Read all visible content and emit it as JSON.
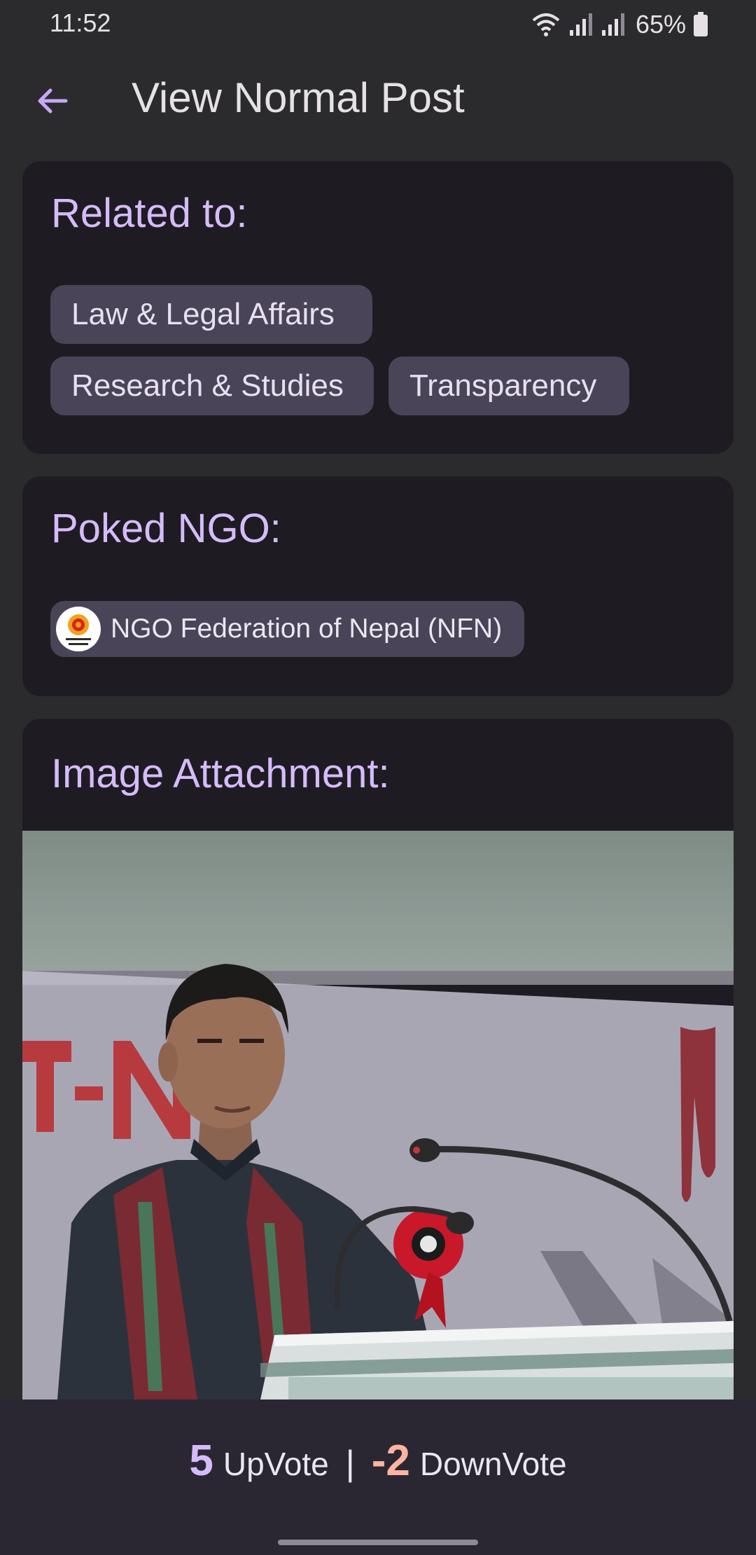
{
  "status_bar": {
    "time": "11:52",
    "battery": "65%"
  },
  "app_bar": {
    "title": "View Normal Post",
    "back_icon": "arrow-left-icon"
  },
  "related": {
    "title": "Related to:",
    "tags": [
      "Law & Legal Affairs",
      "Research & Studies",
      "Transparency"
    ]
  },
  "poked": {
    "title": "Poked NGO:",
    "ngo_name": "NGO Federation of Nepal (NFN)",
    "ngo_logo_text": "NGO Federation of Nepal"
  },
  "attachment": {
    "title": "Image Attachment:",
    "banner_text": "T-N"
  },
  "votes": {
    "up_count": "5",
    "up_label": "UpVote",
    "separator": "|",
    "down_count": "-2",
    "down_label": "DownVote"
  },
  "colors": {
    "accent": "#d6bbfa",
    "downvote": "#ffb4a2",
    "chip_bg": "#4a4458",
    "card_bg": "#1e1c22"
  }
}
